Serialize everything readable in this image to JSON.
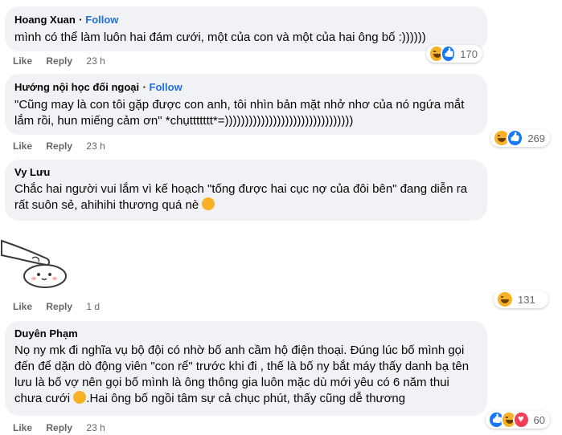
{
  "comments": [
    {
      "author": "Hoang Xuan",
      "follow": "Follow",
      "text": "mình có thể làm luôn hai đám cưới, một của con và một của hai ông bố :))))))",
      "like": "Like",
      "reply": "Reply",
      "time": "23 h",
      "reaction_count": "170",
      "reaction_icons": [
        "haha-icon",
        "like-icon"
      ]
    },
    {
      "author": "Hướng nội học đối ngoại",
      "follow": "Follow",
      "text": "\"Cũng may là con tôi gặp được con anh, tôi nhìn bản mặt nhở nhơ của nó ngứa mắt lắm rồi, hun miếng cảm ơn\" *chụttttttt*=))))))))))))))))))))))))))))))))",
      "like": "Like",
      "reply": "Reply",
      "time": "23 h",
      "reaction_count": "269",
      "reaction_icons": [
        "haha-icon",
        "like-icon"
      ]
    },
    {
      "author": "Vy Lưu",
      "text": "Chắc hai người vui lắm vì kế hoạch \"tống được hai cục nợ của đôi bên\" đang diễn ra rất suôn sẻ, ahihihi thương quá nè",
      "like": "Like",
      "reply": "Reply",
      "time": "1 d",
      "reaction_count": "131",
      "reaction_icons": [
        "haha-icon"
      ]
    },
    {
      "author": "Duyên Phạm",
      "text": "Nọ ny mk đi nghĩa vụ bộ đội có nhờ bố anh cầm hộ điện thoại. Đúng lúc bố mình gọi đến để dặn dò động viên \"con rể\" trước khi đi , thế là bố ny bắt máy thấy danh bạ tên lưu là bố vợ nên gọi bố mình là ông thông gia luôn mặc dù mới yêu có 6 năm thui chưa cưới",
      "text_after_emoji": ".Hai ông bố ngồi tâm sự cả chục phút, thấy cũng dễ thương",
      "like": "Like",
      "reply": "Reply",
      "time": "23 h",
      "reaction_count": "60",
      "reaction_icons": [
        "like-icon",
        "haha-icon",
        "heart-icon"
      ]
    }
  ],
  "colors": {
    "bubble": "#f0f2f5",
    "follow": "#216fdb",
    "meta": "#65676b"
  }
}
